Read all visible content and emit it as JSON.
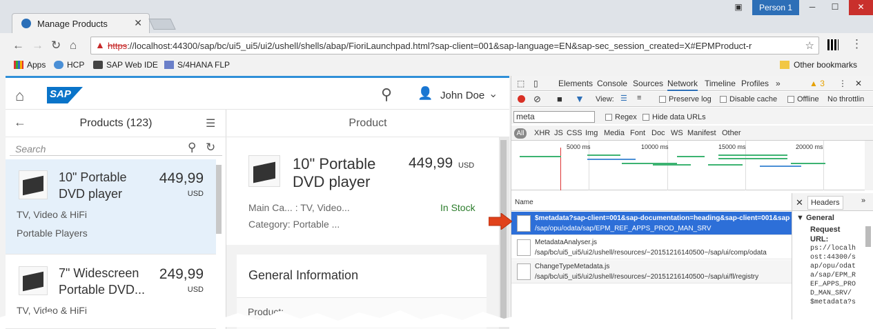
{
  "browser": {
    "tab_title": "Manage Products",
    "profile": "Person 1",
    "url_scheme": "https",
    "url_rest": "://localhost:44300/sap/bc/ui5_ui5/ui2/ushell/shells/abap/FioriLaunchpad.html?sap-client=001&sap-language=EN&sap-sec_session_created=X#EPMProduct-r",
    "bookmarks": [
      "Apps",
      "HCP",
      "SAP Web IDE",
      "S/4HANA FLP"
    ],
    "other_bookmarks": "Other bookmarks"
  },
  "shell": {
    "user": "John Doe"
  },
  "master": {
    "title": "Products (123)",
    "search_placeholder": "Search",
    "items": [
      {
        "name": "10\" Portable DVD player",
        "price": "449,99",
        "currency": "USD",
        "attr1": "TV, Video & HiFi",
        "attr2": "Portable Players"
      },
      {
        "name": "7\" Widescreen Portable DVD...",
        "price": "249,99",
        "currency": "USD",
        "attr1": "TV, Video & HiFi"
      }
    ]
  },
  "detail": {
    "title": "Product",
    "name": "10\" Portable DVD player",
    "price": "449,99",
    "currency": "USD",
    "main_category": "Main Ca... : TV, Video...",
    "category": "Category: Portable ...",
    "status": "In Stock",
    "section_title": "General Information",
    "section_label": "Product:"
  },
  "devtools": {
    "tabs": [
      "Elements",
      "Console",
      "Sources",
      "Network",
      "Timeline",
      "Profiles"
    ],
    "active_tab": "Network",
    "warnings": "3",
    "toolbar": {
      "view": "View:",
      "preserve": "Preserve log",
      "disable_cache": "Disable cache",
      "offline": "Offline",
      "throttle": "No throttlin"
    },
    "filter_value": "meta",
    "regex": "Regex",
    "hide_data": "Hide data URLs",
    "types": [
      "All",
      "XHR",
      "JS",
      "CSS",
      "Img",
      "Media",
      "Font",
      "Doc",
      "WS",
      "Manifest",
      "Other"
    ],
    "ticks": [
      "5000 ms",
      "10000 ms",
      "15000 ms",
      "20000 ms"
    ],
    "name_header": "Name",
    "requests": [
      {
        "l1": "$metadata?sap-client=001&sap-documentation=heading&sap-client=001&sap-la...",
        "l2": "/sap/opu/odata/sap/EPM_REF_APPS_PROD_MAN_SRV"
      },
      {
        "l1": "MetadataAnalyser.js",
        "l2": "/sap/bc/ui5_ui5/ui2/ushell/resources/~20151216140500~/sap/ui/comp/odata"
      },
      {
        "l1": "ChangeTypeMetadata.js",
        "l2": "/sap/bc/ui5_ui5/ui2/ushell/resources/~20151216140500~/sap/ui/fl/registry"
      }
    ],
    "headers_tab": "Headers",
    "general": "General",
    "request_url_label": "Request URL:",
    "request_url_value": "ps://localh\nost:44300/s\nap/opu/odat\na/sap/EPM_R\nEF_APPS_PRO\nD_MAN_SRV/\n$metadata?s"
  }
}
